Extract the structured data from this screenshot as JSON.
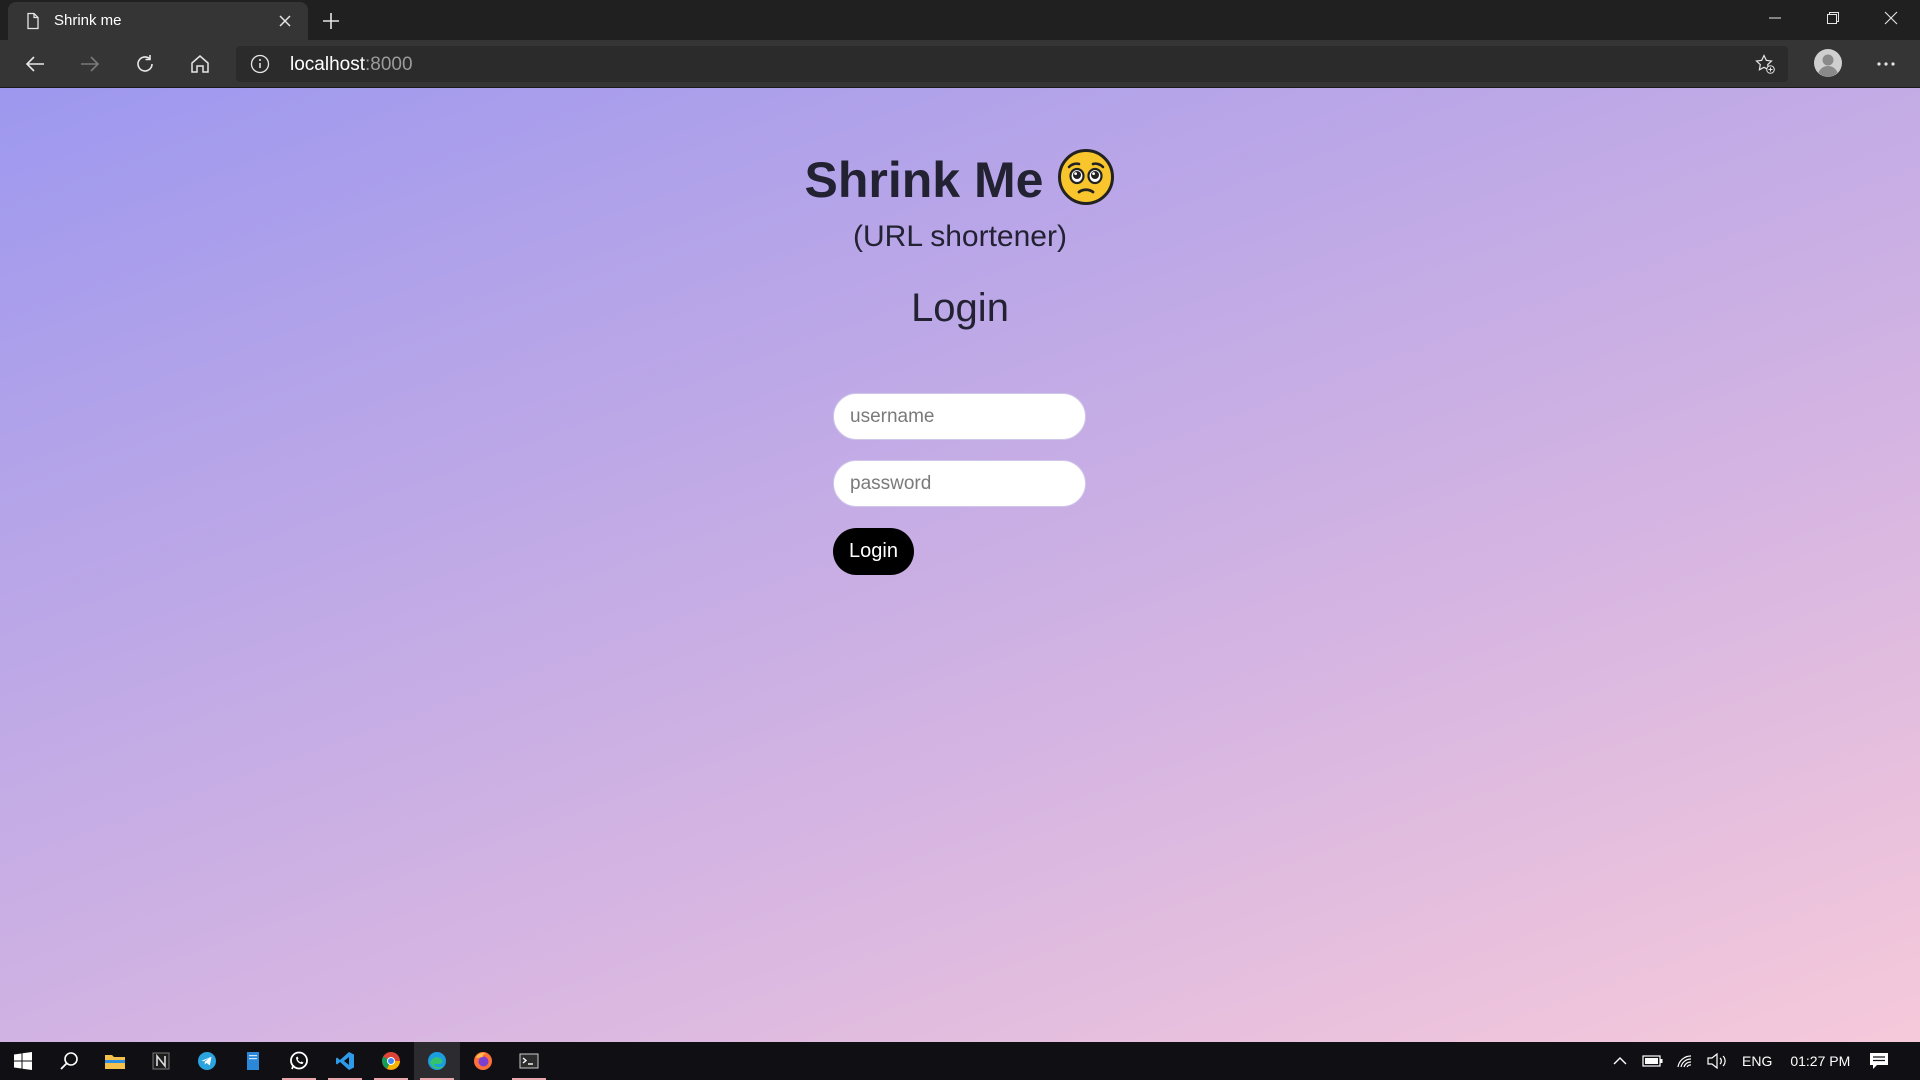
{
  "browser": {
    "tab_title": "Shrink me",
    "url_host": "localhost",
    "url_port": ":8000"
  },
  "page": {
    "title": "Shrink Me",
    "subtitle": "(URL shortener)",
    "form_heading": "Login",
    "username_placeholder": "username",
    "password_placeholder": "password",
    "login_button": "Login"
  },
  "taskbar": {
    "language": "ENG",
    "time": "01:27 PM"
  },
  "colors": {
    "gradient_start": "#9d98ef",
    "gradient_end": "#f6c9da",
    "button_bg": "#000000"
  }
}
